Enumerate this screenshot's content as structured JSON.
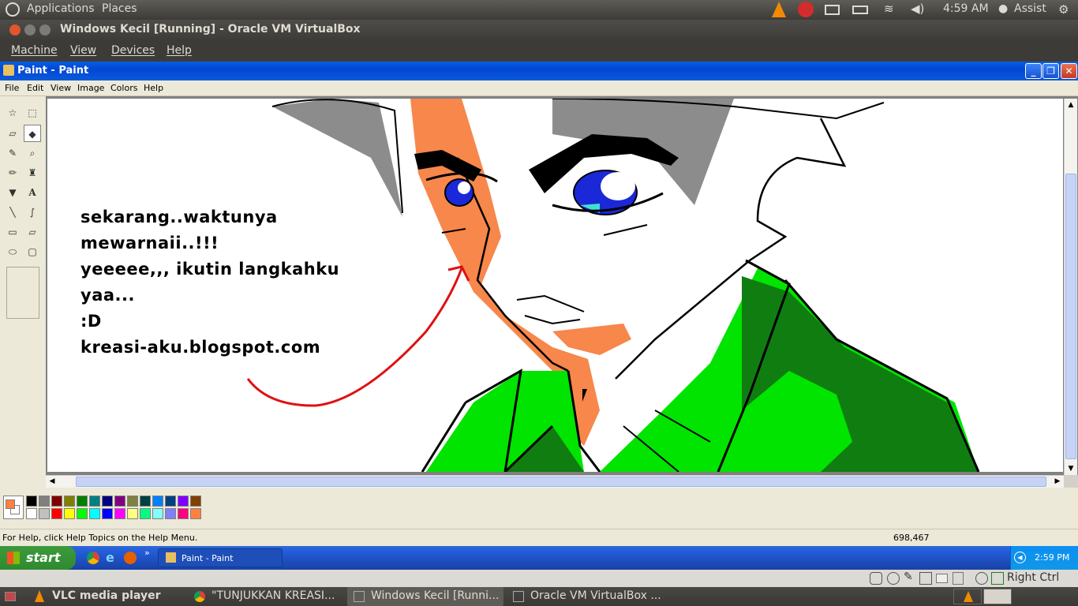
{
  "ubuntu_top": {
    "applications": "Applications",
    "places": "Places",
    "time": "4:59 AM",
    "user": "Assist"
  },
  "vbox": {
    "title": "Windows Kecil [Running] - Oracle VM VirtualBox",
    "menu": [
      "Machine",
      "View",
      "Devices",
      "Help"
    ]
  },
  "paint": {
    "title": "Paint - Paint",
    "menu": [
      "File",
      "Edit",
      "View",
      "Image",
      "Colors",
      "Help"
    ],
    "canvas_text": [
      "sekarang..waktunya",
      "mewarnaii..!!!",
      "yeeeee,,, ikutin langkahku",
      "yaa...",
      ":D",
      "kreasi-aku.blogspot.com"
    ],
    "status_help": "For Help, click Help Topics on the Help Menu.",
    "status_coords": "698,467",
    "palette_top": [
      "#000000",
      "#808080",
      "#800000",
      "#808000",
      "#008000",
      "#008080",
      "#000080",
      "#800080",
      "#808040",
      "#004040",
      "#0080ff",
      "#004080",
      "#8000ff",
      "#804000"
    ],
    "palette_bottom": [
      "#ffffff",
      "#c0c0c0",
      "#ff0000",
      "#ffff00",
      "#00ff00",
      "#00ffff",
      "#0000ff",
      "#ff00ff",
      "#ffff80",
      "#00ff80",
      "#80ffff",
      "#8080ff",
      "#ff0080",
      "#ff8040"
    ],
    "primary_color": "#ff8040",
    "secondary_color": "#ffffff"
  },
  "xp_taskbar": {
    "start": "start",
    "task": "Paint - Paint",
    "clock": "2:59 PM"
  },
  "vb_status": {
    "host_key": "Right Ctrl"
  },
  "ubuntu_bottom": {
    "tasks": [
      "VLC media player",
      "\"TUNJUKKAN KREASI...",
      "Windows Kecil [Runni...",
      "Oracle VM VirtualBox ..."
    ]
  }
}
